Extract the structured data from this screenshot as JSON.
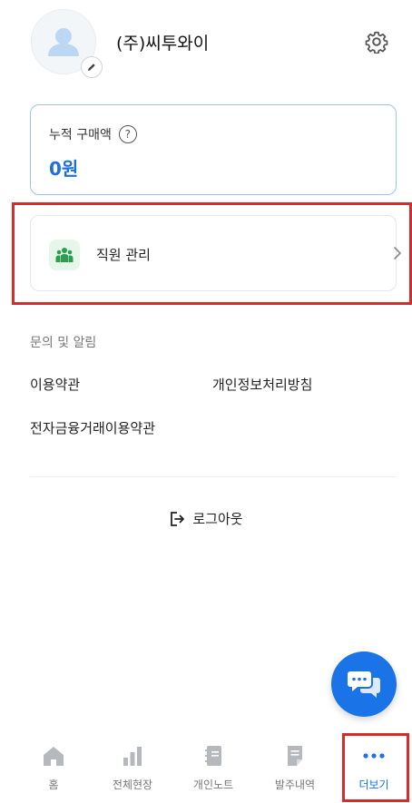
{
  "profile": {
    "company_name": "(주)씨투와이"
  },
  "purchase": {
    "label": "누적 구매액",
    "help_icon": "?",
    "value": "0원"
  },
  "staff": {
    "label": "직원 관리"
  },
  "info": {
    "section_title": "문의 및 알림",
    "links": [
      "이용약관",
      "개인정보처리방침",
      "전자금융거래이용약관"
    ]
  },
  "logout": {
    "label": "로그아웃"
  },
  "bottom_nav": {
    "items": [
      {
        "label": "홈",
        "icon": "home-icon"
      },
      {
        "label": "전체현장",
        "icon": "bar-chart-icon"
      },
      {
        "label": "개인노트",
        "icon": "notebook-icon"
      },
      {
        "label": "발주내역",
        "icon": "document-icon"
      },
      {
        "label": "더보기",
        "icon": "more-icon"
      }
    ],
    "active": "더보기"
  },
  "colors": {
    "accent": "#1a74e8",
    "highlight": "#d62b2b",
    "card_border": "#9cc4ef"
  }
}
